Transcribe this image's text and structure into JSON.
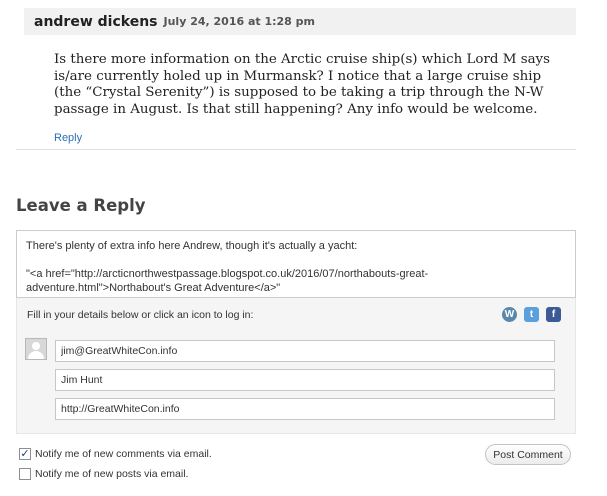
{
  "comment": {
    "author": "andrew dickens",
    "date": "July 24, 2016 at 1:28 pm",
    "body": "Is there more information on the Arctic cruise ship(s) which Lord M says is/are currently holed up in Murmansk? I notice that a large cruise ship (the “Crystal Serenity”) is supposed to be taking a trip through the N-W passage in August. Is that still happening? Any info would be welcome.",
    "reply_label": "Reply"
  },
  "reply_form": {
    "heading": "Leave a Reply",
    "textarea_lines": [
      "There's plenty of extra info here Andrew, though it's actually a yacht:",
      "\"<a href=\"http://arcticnorthwestpassage.blogspot.co.uk/2016/07/northabouts-great-adventure.html\">Northabout's Great Adventure</a>\""
    ],
    "login_prompt": "Fill in your details below or click an icon to log in:",
    "social_icons": [
      "wordpress-icon",
      "twitter-icon",
      "facebook-icon"
    ],
    "fields": {
      "email": "jim@GreatWhiteCon.info",
      "name": "Jim Hunt",
      "website": "http://GreatWhiteCon.info"
    },
    "notify_comments": {
      "label": "Notify me of new comments via email.",
      "checked": true
    },
    "notify_posts": {
      "label": "Notify me of new posts via email.",
      "checked": false
    },
    "submit_label": "Post Comment"
  },
  "colors": {
    "link": "#2b6fb6",
    "header_bg": "#f1f1f1",
    "form_bg": "#f5f5f5"
  }
}
